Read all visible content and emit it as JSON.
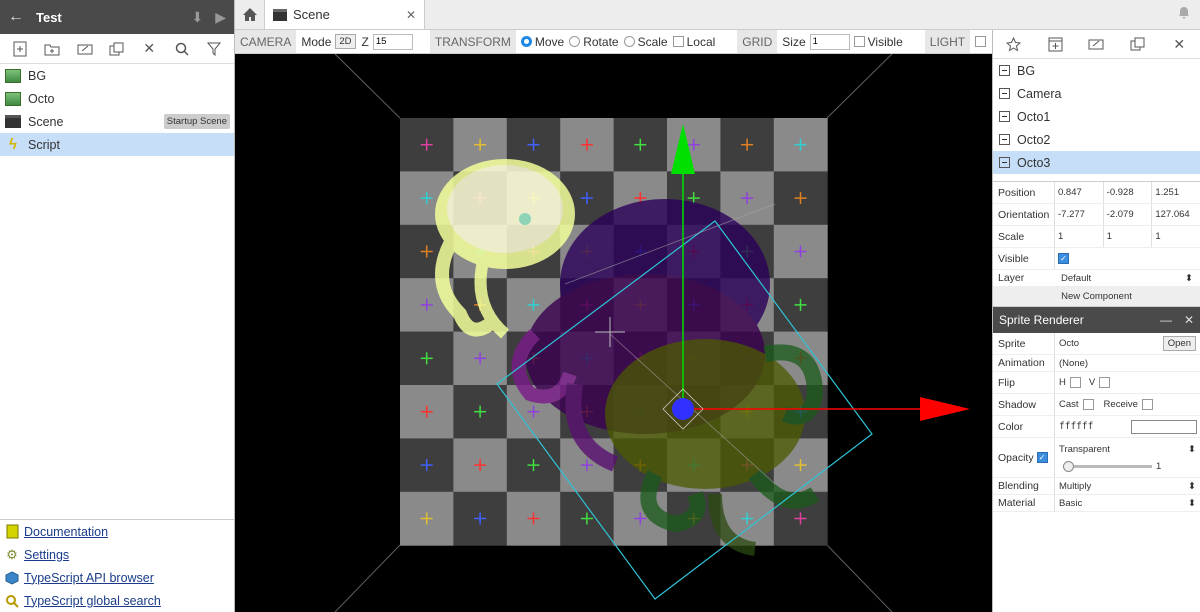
{
  "project": {
    "title": "Test",
    "back_icon": "arrow-left-icon"
  },
  "left_toolbar": {
    "icons": [
      "new-asset-icon",
      "new-folder-icon",
      "rename-icon",
      "duplicate-icon",
      "delete-icon",
      "search-icon",
      "filter-icon"
    ]
  },
  "assets": [
    {
      "label": "BG",
      "icon": "image-icon",
      "selected": false
    },
    {
      "label": "Octo",
      "icon": "image-icon",
      "selected": false
    },
    {
      "label": "Scene",
      "icon": "scene-icon",
      "badge": "Startup Scene",
      "selected": false
    },
    {
      "label": "Script",
      "icon": "script-icon",
      "selected": true
    }
  ],
  "links": [
    {
      "label": "Documentation",
      "icon": "book-icon"
    },
    {
      "label": "Settings",
      "icon": "gear-icon"
    },
    {
      "label": "TypeScript API browser",
      "icon": "cube-icon"
    },
    {
      "label": "TypeScript global search",
      "icon": "search-icon"
    }
  ],
  "tabs": [
    {
      "label": "Scene",
      "icon": "scene-icon",
      "active": true
    }
  ],
  "scene_toolbar": {
    "camera_label": "CAMERA",
    "mode_label": "Mode",
    "mode_value": "2D",
    "z_label": "Z",
    "z_value": "15",
    "transform_label": "TRANSFORM",
    "transform_options": [
      {
        "label": "Move",
        "selected": true
      },
      {
        "label": "Rotate",
        "selected": false
      },
      {
        "label": "Scale",
        "selected": false
      }
    ],
    "local_label": "Local",
    "grid_label": "GRID",
    "size_label": "Size",
    "size_value": "1",
    "visible_label": "Visible",
    "light_label": "LIGHT"
  },
  "viewport": {
    "grid_light": "#8a8a8a",
    "grid_dark": "#3e3e3e",
    "gizmo_y_color": "#00e000",
    "gizmo_x_color": "#ff0000",
    "gizmo_center_color": "#3030ff",
    "selection_color": "#2ec4d6"
  },
  "right_toolbar": {
    "icons": [
      "new-actor-icon",
      "new-prefab-icon",
      "rename-icon",
      "duplicate-icon",
      "delete-icon"
    ]
  },
  "nodes": [
    {
      "label": "BG",
      "selected": false
    },
    {
      "label": "Camera",
      "selected": false
    },
    {
      "label": "Octo1",
      "selected": false
    },
    {
      "label": "Octo2",
      "selected": false
    },
    {
      "label": "Octo3",
      "selected": true
    }
  ],
  "transform": {
    "position_label": "Position",
    "position": [
      "0.847",
      "-0.928",
      "1.251"
    ],
    "orientation_label": "Orientation",
    "orientation": [
      "-7.277",
      "-2.079",
      "127.064"
    ],
    "scale_label": "Scale",
    "scale": [
      "1",
      "1",
      "1"
    ],
    "visible_label": "Visible",
    "visible": true,
    "layer_label": "Layer",
    "layer_value": "Default",
    "new_component_label": "New Component"
  },
  "sprite_renderer": {
    "title": "Sprite Renderer",
    "sprite_label": "Sprite",
    "sprite_value": "Octo",
    "open_label": "Open",
    "animation_label": "Animation",
    "animation_value": "(None)",
    "flip_label": "Flip",
    "flip_h": "H",
    "flip_v": "V",
    "shadow_label": "Shadow",
    "cast_label": "Cast",
    "receive_label": "Receive",
    "color_label": "Color",
    "color_value": "ffffff",
    "opacity_label": "Opacity",
    "opacity_mode": "Transparent",
    "opacity_value": "1",
    "blending_label": "Blending",
    "blending_value": "Multiply",
    "material_label": "Material",
    "material_value": "Basic"
  }
}
